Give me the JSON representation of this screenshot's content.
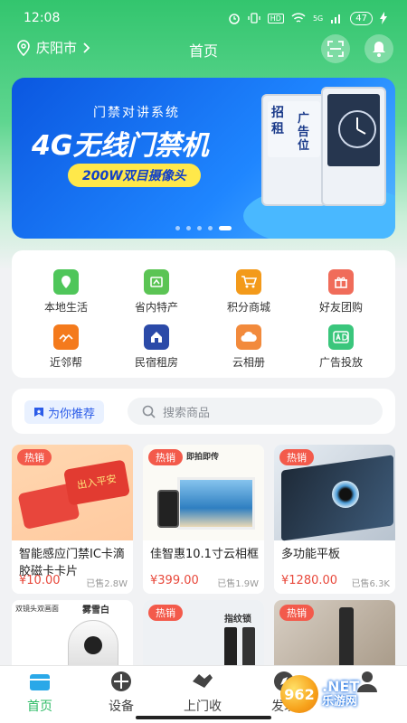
{
  "status_bar": {
    "time": "12:08",
    "icons": [
      "alarm-icon",
      "vibrate-icon",
      "hd-icon",
      "wifi-icon",
      "signal-icon"
    ],
    "hd_label": "HD",
    "signal_label": "5G",
    "battery": "47"
  },
  "header": {
    "city": "庆阳市",
    "title": "首页"
  },
  "banner": {
    "subtitle": "门禁对讲系统",
    "title": "4G无线门禁机",
    "tagline": "200W双目摄像头",
    "device_words": [
      "招",
      "租",
      "广告位"
    ],
    "slides": 5,
    "active_slide": 4
  },
  "menu": [
    {
      "label": "本地生活",
      "icon": "location-pin-icon",
      "color": "#4fc65a"
    },
    {
      "label": "省内特产",
      "icon": "specialty-icon",
      "color": "#5bc454"
    },
    {
      "label": "积分商城",
      "icon": "cart-icon",
      "color": "#f39a1a"
    },
    {
      "label": "好友团购",
      "icon": "gift-icon",
      "color": "#f06c5a"
    },
    {
      "label": "近邻帮",
      "icon": "helping-hands-icon",
      "color": "#f47a1c"
    },
    {
      "label": "民宿租房",
      "icon": "house-icon",
      "color": "#2b4aa8"
    },
    {
      "label": "云相册",
      "icon": "cloud-album-icon",
      "color": "#f28a3c"
    },
    {
      "label": "广告投放",
      "icon": "ad-icon",
      "color": "#3ac67c"
    }
  ],
  "recommend": {
    "tag": "为你推荐",
    "search_placeholder": "搜索商品"
  },
  "products": [
    {
      "badge": "热销",
      "name": "智能感应门禁IC卡滴胶磁卡卡片",
      "price": "¥10.00",
      "sold": "已售2.8W",
      "img_text": "出入平安"
    },
    {
      "badge": "热销",
      "name": "佳智惠10.1寸云相框",
      "price": "¥399.00",
      "sold": "已售1.9W",
      "img_text": "即拍即传"
    },
    {
      "badge": "热销",
      "name": "多功能平板",
      "price": "¥1280.00",
      "sold": "已售6.3K",
      "img_text": ""
    }
  ],
  "products_row2": [
    {
      "badge": "",
      "img_text": "双镜头双画面",
      "img_text2": "雾雪白"
    },
    {
      "badge": "热销",
      "img_text": "指纹锁"
    },
    {
      "badge": "热销",
      "img_text": ""
    }
  ],
  "tabbar": [
    {
      "label": "首页",
      "active": true
    },
    {
      "label": "设备",
      "active": false
    },
    {
      "label": "上门收",
      "active": false
    },
    {
      "label": "发现",
      "active": false
    }
  ],
  "watermark": {
    "number": "962",
    "suffix": ".NET",
    "sub": "乐游网"
  }
}
